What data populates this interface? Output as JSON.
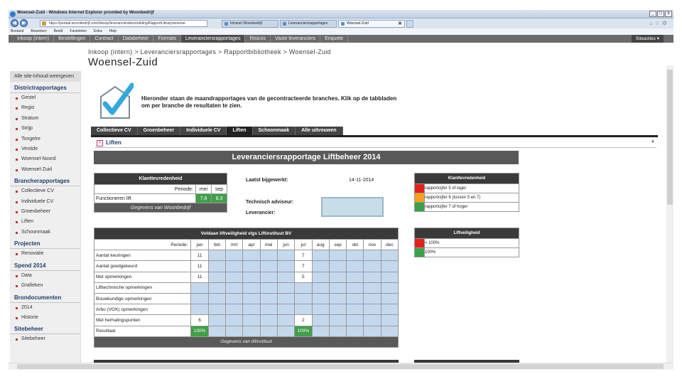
{
  "browser": {
    "title": "Woensel-Zuid - Windows Internet Explorer provided by Woonbedrijf",
    "url": "https://portaal.woonbedrijf.com/inkoop/leveranciersbeoordeling/RapportLibrary/woense",
    "tabs": [
      {
        "label": "Intranet Woonbedrijf"
      },
      {
        "label": "Leveranciersrapportages"
      },
      {
        "label": "Woensel-Zuid",
        "active": true
      }
    ],
    "menu": [
      "Bestand",
      "Bewerken",
      "Beeld",
      "Favorieten",
      "Extra",
      "Help"
    ],
    "window_buttons": [
      "_",
      "□",
      "x"
    ]
  },
  "site_nav": {
    "items": [
      "Inkoop (intern)",
      "Bestellingen",
      "Contract",
      "Databeheer",
      "Formats",
      "Leveranciersrapportages",
      "Risicos",
      "Vaste leveranciers",
      "Enquete"
    ],
    "active_index": 5,
    "actions_label": "Siteacties ▾"
  },
  "breadcrumb": "Inkoop (intern) > Leveranciersrapportages > Rapportbibliotheek > Woensel-Zuid",
  "page_title": "Woensel-Zuid",
  "sidebar": {
    "all_content": "Alle site-inhoud weergeven",
    "sections": [
      {
        "title": "Districtrapportages",
        "items": [
          "Gestel",
          "Regio",
          "Stratum",
          "Strijp",
          "Tongelre",
          "Vestide",
          "Woensel-Noord",
          "Woensel-Zuid"
        ]
      },
      {
        "title": "Brancherapportages",
        "items": [
          "Collectieve CV",
          "Individuele CV",
          "Groenbeheer",
          "Liften",
          "Schoonmaak"
        ]
      },
      {
        "title": "Projecten",
        "items": [
          "Renovatie"
        ]
      },
      {
        "title": "Spend 2014",
        "items": [
          "Data",
          "Grafieken"
        ]
      },
      {
        "title": "Brondocumenten",
        "items": [
          "2014",
          "Historie"
        ]
      },
      {
        "title": "Sitebeheer",
        "items": [
          "Sitebeheer"
        ]
      }
    ]
  },
  "intro_text": "Hieronder staan de maandrapportages van de gecontracteerde branches. Klik op de tabbladen om per branche de resultaten te zien.",
  "content_tabs": [
    "Collectieve CV",
    "Groenbeheer",
    "Individuele CV",
    "Liften",
    "Schoonmaak",
    "Alle uitvouwen"
  ],
  "content_active_tab": 3,
  "webpart_title": "Liften",
  "report_title": "Leveranciersrapportage Liftbeheer 2014",
  "klanttevredenheid": {
    "title": "Klanttevredenheid",
    "period_label": "Periode:",
    "months": [
      "mei",
      "sep"
    ],
    "row_label": "Functioneren lift",
    "values": [
      "7,6",
      "8,3"
    ],
    "source": "Gegevens van Woonbedrijf"
  },
  "meta": {
    "last_updated_label": "Laatst bijgewerkt:",
    "last_updated_value": "14-11-2014",
    "advisor_label": "Technisch adviseur:",
    "supplier_label": "Leverancier:"
  },
  "legend_kt": {
    "title": "Klanttevredenheid",
    "rows": [
      {
        "color": "#e32019",
        "text": "rapportcijfer 5 of lager"
      },
      {
        "color": "#f5a11c",
        "text": "rapportcijfer 6 (tussen 5 en 7)"
      },
      {
        "color": "#3aa14a",
        "text": "rapportcijfer 7 of hoger"
      }
    ]
  },
  "legend_ls": {
    "title": "Liftveiligheid",
    "rows": [
      {
        "color": "#e32019",
        "text": "< 100%"
      },
      {
        "color": "#3aa14a",
        "text": "100%"
      }
    ]
  },
  "liftveiligheid": {
    "title": "Voldaan liftveiligheid vlgs Liftinstituut BV",
    "period_label": "Periode:",
    "months": [
      "jan",
      "feb",
      "mrt",
      "apr",
      "mei",
      "jun",
      "jul",
      "aug",
      "sep",
      "okt",
      "nov",
      "dec"
    ],
    "rows": [
      {
        "label": "Aantal keuringen",
        "values": [
          "11",
          "",
          "",
          "",
          "",
          "",
          "7",
          "",
          "",
          "",
          "",
          ""
        ]
      },
      {
        "label": "Aantal goedgekeurd",
        "values": [
          "11",
          "",
          "",
          "",
          "",
          "",
          "7",
          "",
          "",
          "",
          "",
          ""
        ]
      },
      {
        "label": "Met opmerkingen",
        "values": [
          "11",
          "",
          "",
          "",
          "",
          "",
          "5",
          "",
          "",
          "",
          "",
          ""
        ]
      },
      {
        "label": "Lifttechnische opmerkingen",
        "values": [
          "",
          "",
          "",
          "",
          "",
          "",
          "",
          "",
          "",
          "",
          "",
          ""
        ]
      },
      {
        "label": "Bouwkundige opmerkingen",
        "values": [
          "",
          "",
          "",
          "",
          "",
          "",
          "",
          "",
          "",
          "",
          "",
          ""
        ]
      },
      {
        "label": "Arbo (VGK) opmerkingen",
        "values": [
          "",
          "",
          "",
          "",
          "",
          "",
          "",
          "",
          "",
          "",
          "",
          ""
        ]
      },
      {
        "label": "Met herhalingspunten",
        "values": [
          "6",
          "",
          "",
          "",
          "",
          "",
          "2",
          "",
          "",
          "",
          "",
          ""
        ]
      },
      {
        "label": "Resultaat",
        "values": [
          "100%",
          "",
          "",
          "",
          "",
          "",
          "100%",
          "",
          "",
          "",
          "",
          ""
        ],
        "result": true
      }
    ],
    "source": "Gegevens van liftinstituut"
  }
}
